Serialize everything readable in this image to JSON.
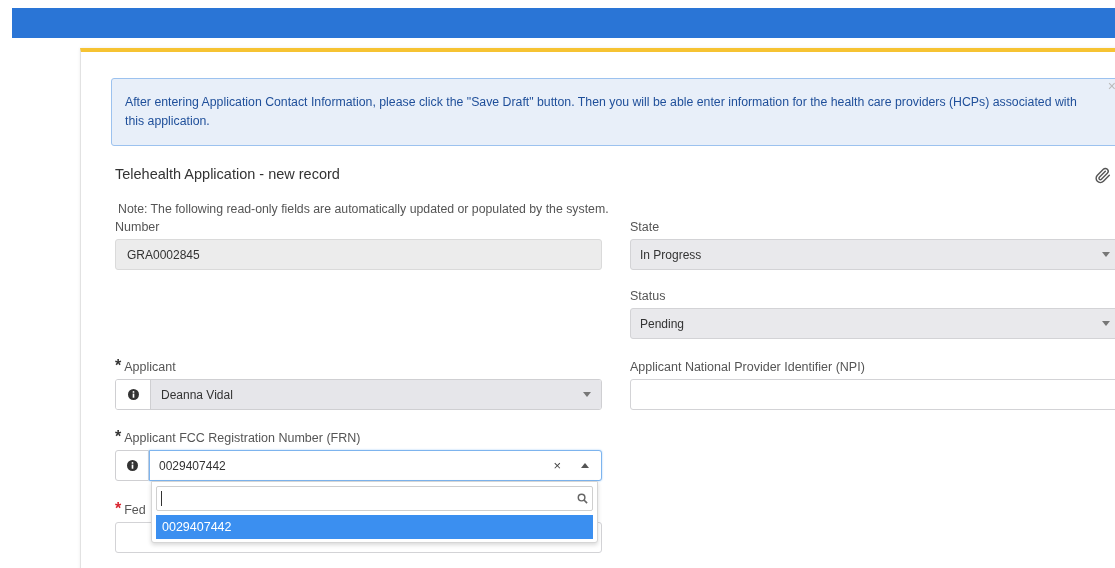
{
  "alert": {
    "message": "After entering Application Contact Information, please click the \"Save Draft\" button. Then you will be able enter information for the health care providers (HCPs) associated with this application.",
    "close": "×"
  },
  "form": {
    "title": "Telehealth Application - new record",
    "note": "Note: The following read-only fields are automatically updated or populated by the system."
  },
  "number": {
    "label": "Number",
    "value": "GRA0002845"
  },
  "state": {
    "label": "State",
    "value": "In Progress"
  },
  "status": {
    "label": "Status",
    "value": "Pending"
  },
  "applicant": {
    "label": "Applicant",
    "required_mark": "*",
    "color": "#333333",
    "value": "Deanna Vidal"
  },
  "npi": {
    "label": "Applicant National Provider Identifier (NPI)"
  },
  "frn": {
    "label": "Applicant FCC Registration Number (FRN)",
    "required_mark": "*",
    "color": "#333333",
    "value": "0029407442",
    "clear": "×",
    "expanded": true,
    "options": [
      {
        "label": "0029407442",
        "selected": true
      }
    ]
  },
  "federal": {
    "label": "Fed",
    "required_mark": "*",
    "color": "#d9232e"
  }
}
